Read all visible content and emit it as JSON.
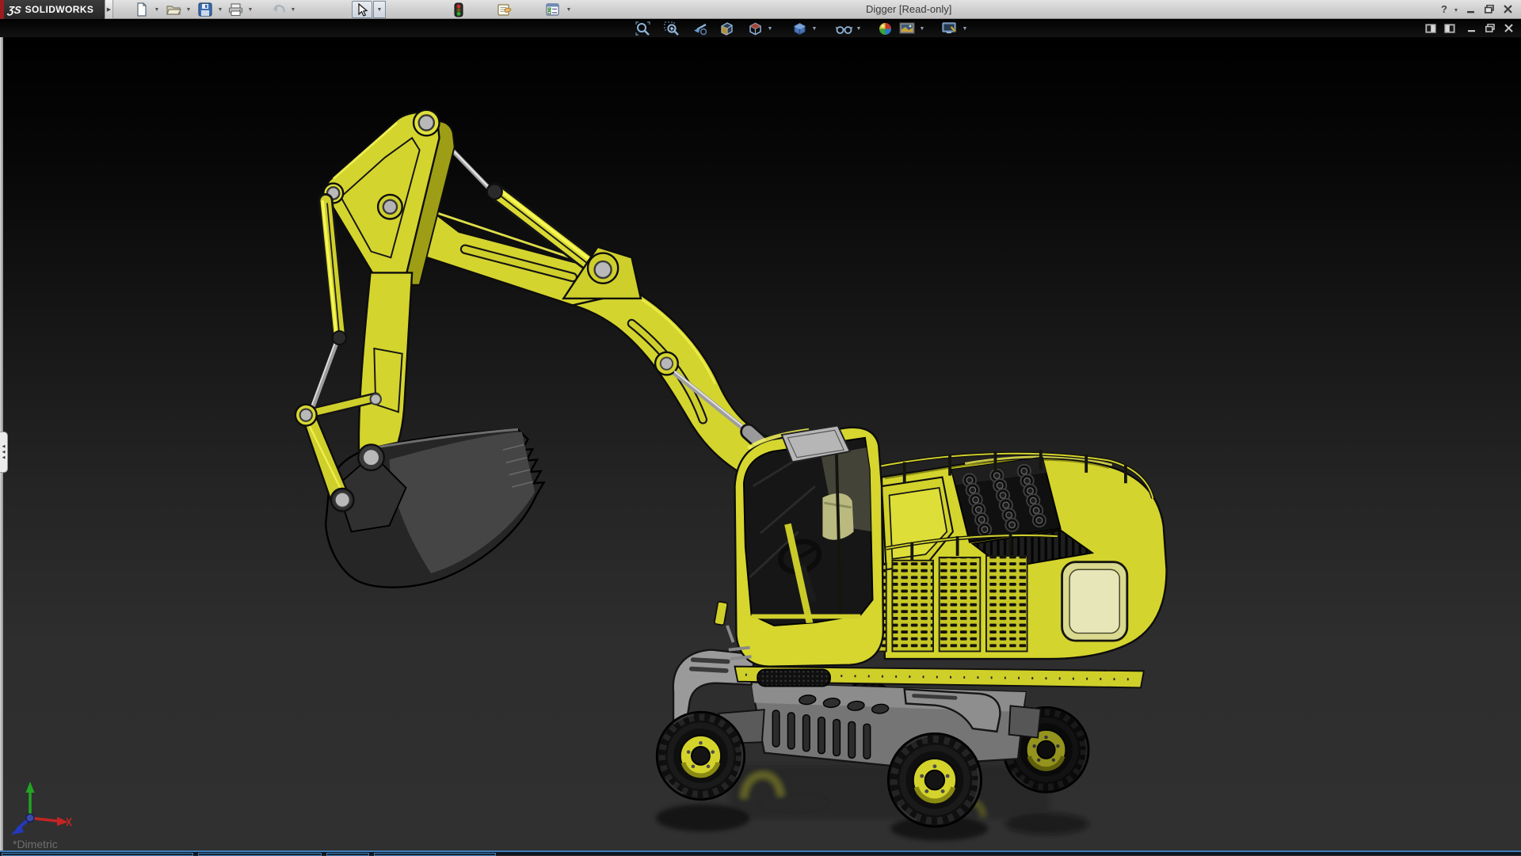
{
  "window": {
    "title": "Digger [Read-only]",
    "brand": {
      "mark": "ƷS",
      "name": "SOLIDWORKS"
    }
  },
  "titlebar": {
    "help_glyph": "?",
    "controls": [
      "help",
      "help-dropdown",
      "minimize",
      "restore",
      "close"
    ]
  },
  "main_toolbar": {
    "items": [
      {
        "name": "new-document",
        "has_dropdown": true
      },
      {
        "name": "open-document",
        "has_dropdown": true
      },
      {
        "name": "save",
        "has_dropdown": true
      },
      {
        "name": "print",
        "has_dropdown": true
      },
      {
        "name": "undo",
        "has_dropdown": true,
        "disabled": true
      },
      {
        "name": "select",
        "has_dropdown": true,
        "pressed": true
      },
      {
        "name": "rebuild-traffic-light",
        "has_dropdown": false
      },
      {
        "name": "file-properties",
        "has_dropdown": false
      },
      {
        "name": "options",
        "has_dropdown": true
      }
    ]
  },
  "document_bar": {
    "controls": [
      "featuremanager-pane-left",
      "featuremanager-pane-right",
      "minimize",
      "restore",
      "close"
    ]
  },
  "headsup_toolbar": {
    "items": [
      {
        "name": "zoom-to-fit",
        "has_dropdown": false
      },
      {
        "name": "zoom-to-area",
        "has_dropdown": false
      },
      {
        "name": "previous-view",
        "has_dropdown": false
      },
      {
        "name": "section-view",
        "has_dropdown": false
      },
      {
        "name": "view-orientation",
        "has_dropdown": true
      },
      {
        "name": "display-style",
        "has_dropdown": true
      },
      {
        "name": "hide-show-items",
        "has_dropdown": true
      },
      {
        "name": "edit-appearance",
        "has_dropdown": false
      },
      {
        "name": "apply-scene",
        "has_dropdown": true
      },
      {
        "name": "view-settings",
        "has_dropdown": true
      }
    ]
  },
  "viewport": {
    "orientation_label": "*Dimetric",
    "background_top": "#000000",
    "background_bottom": "#303030",
    "model": {
      "name": "digger-excavator",
      "body_color": "#d4d42e",
      "highlight_color": "#f4f452",
      "outline_color": "#0d0d0d",
      "glass_color": "#161616",
      "metal_color": "#a8a8a8",
      "tire_color": "#0f0f0f",
      "chassis_color": "#787878"
    },
    "triad": {
      "x_color": "#c42424",
      "y_color": "#22a422",
      "z_color": "#2438c0"
    }
  },
  "featuremanager_tab": {
    "arrow": "◀"
  },
  "taskbar": {
    "accent_color": "#3e7cb8",
    "button_count": 4
  }
}
